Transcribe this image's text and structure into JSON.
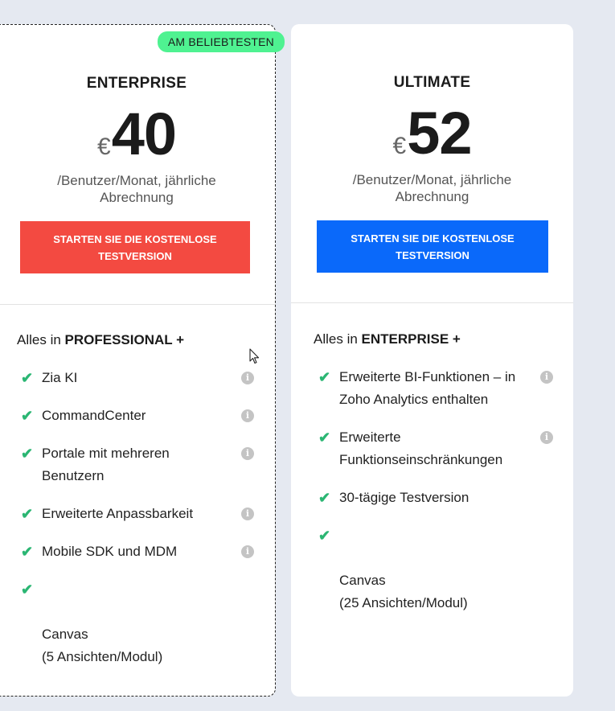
{
  "plans": [
    {
      "badge": "AM BELIEBTESTEN",
      "name": "ENTERPRISE",
      "currency": "€",
      "amount": "40",
      "period": "/Benutzer/Monat, jährliche Abrechnung",
      "cta": "STARTEN SIE DIE KOSTENLOSE TESTVERSION",
      "cta_color": "#f34a41",
      "includes_prefix": "Alles in ",
      "includes_plan": "PROFESSIONAL +",
      "features": [
        {
          "label": "Zia KI",
          "info": true
        },
        {
          "label": "CommandCenter",
          "info": true
        },
        {
          "label": "Portale mit mehreren Benutzern",
          "info": true
        },
        {
          "label": "Erweiterte Anpassbarkeit",
          "info": true
        },
        {
          "label": "Mobile SDK und MDM",
          "info": true
        },
        {
          "label": "Canvas\n(5 Ansichten/Modul)",
          "info": false
        }
      ]
    },
    {
      "name": "ULTIMATE",
      "currency": "€",
      "amount": "52",
      "period": "/Benutzer/Monat, jährliche Abrechnung",
      "cta": "STARTEN SIE DIE KOSTENLOSE TESTVERSION",
      "cta_color": "#0a69fa",
      "includes_prefix": "Alles in ",
      "includes_plan": "ENTERPRISE +",
      "features": [
        {
          "label": "Erweiterte BI-Funktionen – in Zoho Analytics enthalten",
          "info": true
        },
        {
          "label": "Erweiterte Funktionseinschränkungen",
          "info": true
        },
        {
          "label": "30-tägige Testversion",
          "info": false
        },
        {
          "label": "Canvas\n(25 Ansichten/Modul)",
          "info": false
        }
      ]
    }
  ],
  "icons": {
    "check": "check-icon",
    "info": "info-icon",
    "cursor": "mouse-pointer-icon"
  },
  "colors": {
    "badge": "#4ff291",
    "check": "#2bb673",
    "background": "#e5e9f1"
  }
}
